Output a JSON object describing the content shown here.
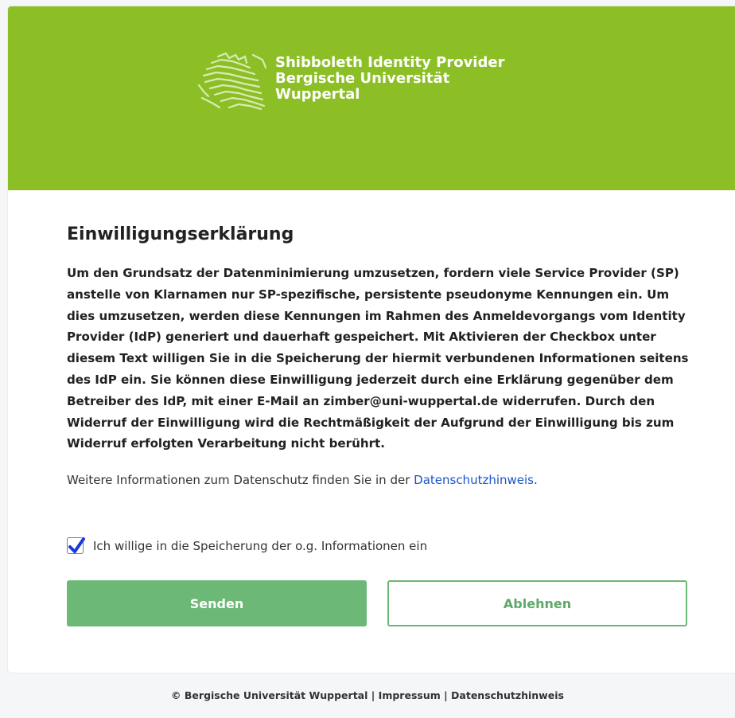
{
  "header": {
    "title_lines": [
      "Shibboleth Identity Provider",
      "Bergische Universität",
      "Wuppertal"
    ],
    "logo_icon": "university-lion-logo"
  },
  "main": {
    "heading": "Einwilligungserklärung",
    "consent_text": "Um den Grundsatz der Datenminimierung umzusetzen, fordern viele Service Provider (SP) anstelle von Klarnamen nur SP-spezifische, persistente pseudonyme Kennungen ein. Um dies umzusetzen, werden diese Kennungen im Rahmen des Anmeldevorgangs vom Identity Provider (IdP) generiert und dauerhaft gespeichert. Mit Aktivieren der Checkbox unter diesem Text willigen Sie in die Speicherung der hiermit verbundenen Informationen seitens des IdP ein. Sie können diese Einwilligung jederzeit durch eine Erklärung gegenüber dem Betreiber des IdP, mit einer E-Mail an zimber@uni-wuppertal.de widerrufen. Durch den Widerruf der Einwilligung wird die Rechtmäßigkeit der Aufgrund der Einwilligung bis zum Widerruf erfolgten Verarbeitung nicht berührt.",
    "info_prefix": "Weitere Informationen zum Datenschutz finden Sie in der ",
    "info_link": "Datenschutzhinweis",
    "info_suffix": ".",
    "checkbox_label": "Ich willige in die Speicherung der o.g. Informationen ein",
    "checkbox_checked": true
  },
  "buttons": {
    "send": "Senden",
    "decline": "Ablehnen"
  },
  "footer": {
    "copyright": "© Bergische Universität Wuppertal",
    "separator": " | ",
    "impressum": "Impressum",
    "privacy": "Datenschutzhinweis"
  },
  "colors": {
    "header_green": "#8cbf26",
    "button_green": "#6bb877",
    "link_blue": "#1a55c8"
  }
}
